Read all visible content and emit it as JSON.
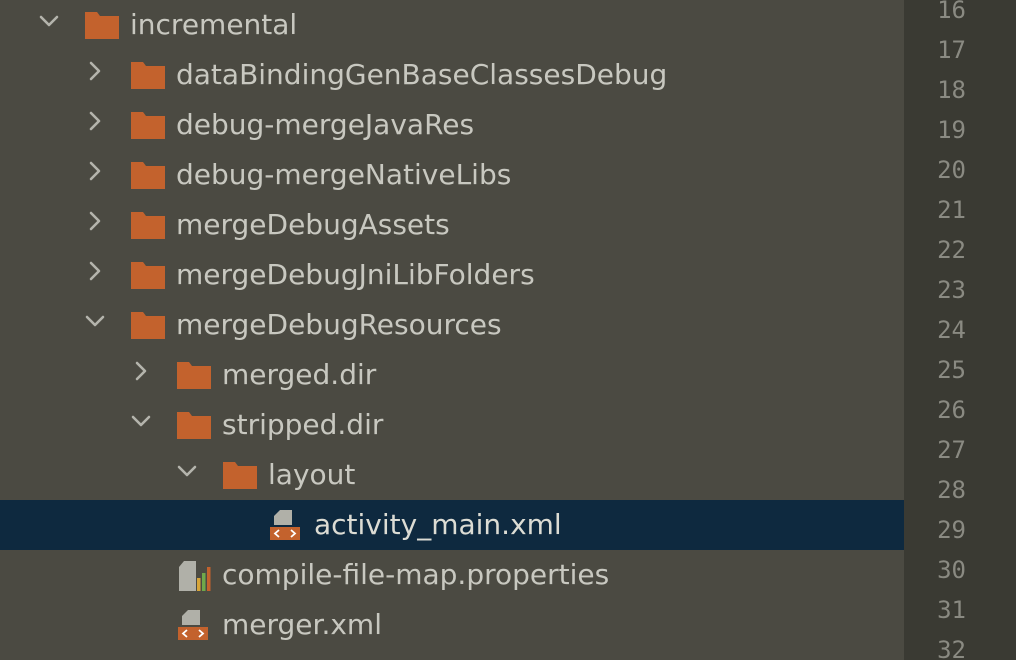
{
  "tree": {
    "nodes": [
      {
        "label": "incremental",
        "depth": 0,
        "toggle": "expanded",
        "icon": "folder-icon",
        "name": "tree-node-incremental",
        "selected": false
      },
      {
        "label": "dataBindingGenBaseClassesDebug",
        "depth": 1,
        "toggle": "collapsed",
        "icon": "folder-icon",
        "name": "tree-node-dataBindingGenBaseClassesDebug",
        "selected": false
      },
      {
        "label": "debug-mergeJavaRes",
        "depth": 1,
        "toggle": "collapsed",
        "icon": "folder-icon",
        "name": "tree-node-debug-mergeJavaRes",
        "selected": false
      },
      {
        "label": "debug-mergeNativeLibs",
        "depth": 1,
        "toggle": "collapsed",
        "icon": "folder-icon",
        "name": "tree-node-debug-mergeNativeLibs",
        "selected": false
      },
      {
        "label": "mergeDebugAssets",
        "depth": 1,
        "toggle": "collapsed",
        "icon": "folder-icon",
        "name": "tree-node-mergeDebugAssets",
        "selected": false
      },
      {
        "label": "mergeDebugJniLibFolders",
        "depth": 1,
        "toggle": "collapsed",
        "icon": "folder-icon",
        "name": "tree-node-mergeDebugJniLibFolders",
        "selected": false
      },
      {
        "label": "mergeDebugResources",
        "depth": 1,
        "toggle": "expanded",
        "icon": "folder-icon",
        "name": "tree-node-mergeDebugResources",
        "selected": false
      },
      {
        "label": "merged.dir",
        "depth": 2,
        "toggle": "collapsed",
        "icon": "folder-icon",
        "name": "tree-node-merged-dir",
        "selected": false
      },
      {
        "label": "stripped.dir",
        "depth": 2,
        "toggle": "expanded",
        "icon": "folder-icon",
        "name": "tree-node-stripped-dir",
        "selected": false
      },
      {
        "label": "layout",
        "depth": 3,
        "toggle": "expanded",
        "icon": "folder-icon",
        "name": "tree-node-layout",
        "selected": false
      },
      {
        "label": "activity_main.xml",
        "depth": 4,
        "toggle": "none",
        "icon": "xml-file-icon",
        "name": "tree-node-activity-main-xml",
        "selected": true
      },
      {
        "label": "compile-file-map.properties",
        "depth": 2,
        "toggle": "none",
        "icon": "properties-file-icon",
        "name": "tree-node-compile-file-map-properties",
        "selected": false
      },
      {
        "label": "merger.xml",
        "depth": 2,
        "toggle": "none",
        "icon": "xml-file-icon",
        "name": "tree-node-merger-xml",
        "selected": false
      }
    ]
  },
  "gutter": {
    "line_numbers": [
      "16",
      "17",
      "18",
      "19",
      "20",
      "21",
      "22",
      "23",
      "24",
      "25",
      "26",
      "27",
      "28",
      "29",
      "30",
      "31",
      "32"
    ]
  },
  "colors": {
    "panel_bg": "#4b4a42",
    "gutter_bg": "#3a3a33",
    "selection_bg": "#0e293f",
    "folder": "#c3622d",
    "text": "#c8c8c0",
    "line_number": "#8a8a82",
    "chevron": "#b4b4ac"
  }
}
